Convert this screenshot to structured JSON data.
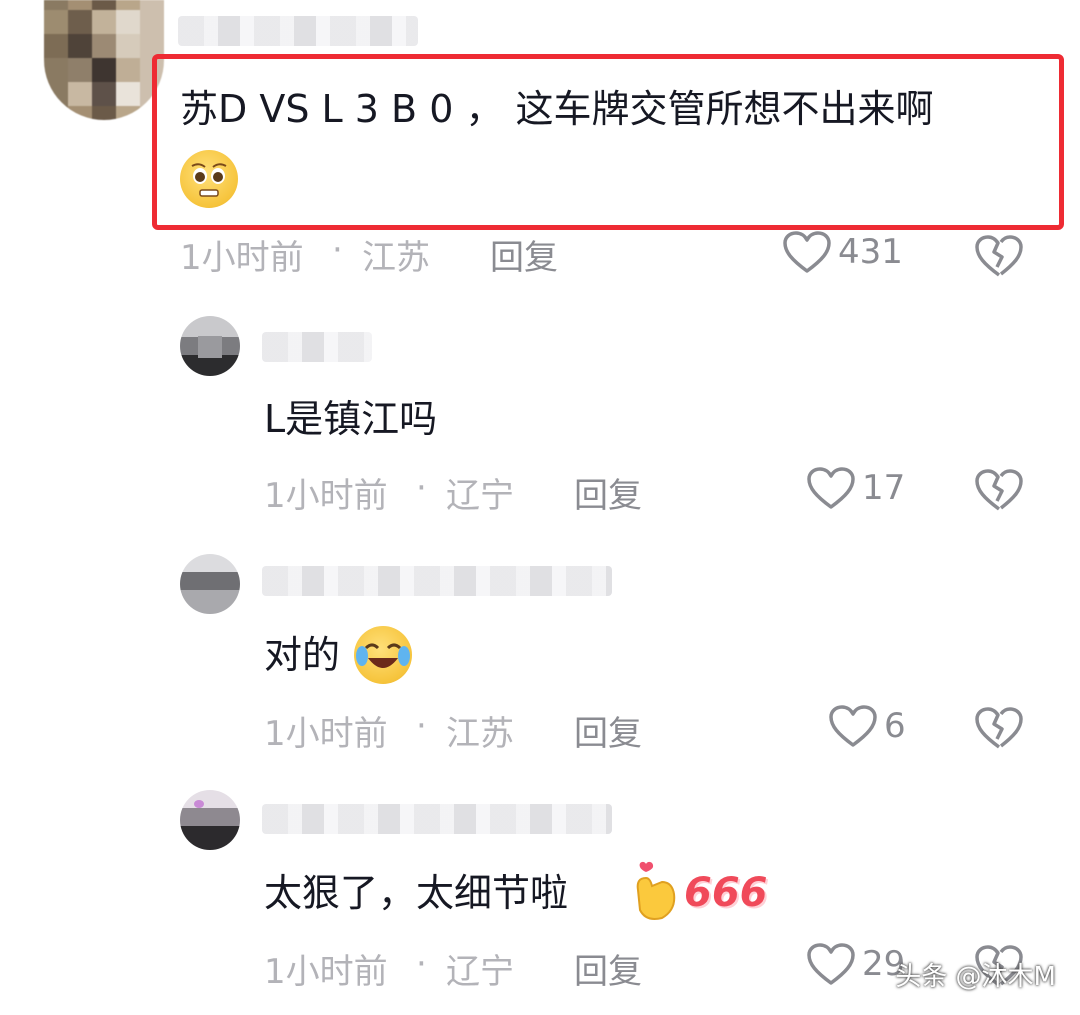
{
  "main_comment": {
    "text_line1": "苏D VS L 3 B 0 ， 这车牌交管所想不出来啊",
    "emoji_icon": "pleading-face-emoji",
    "time": "1小时前",
    "location": "江苏",
    "reply_label": "回复",
    "likes": "431"
  },
  "replies": [
    {
      "text": "L是镇江吗",
      "time": "1小时前",
      "location": "辽宁",
      "reply_label": "回复",
      "likes": "17"
    },
    {
      "text": "对的",
      "emoji_icon": "laughing-crying-emoji",
      "time": "1小时前",
      "location": "江苏",
      "reply_label": "回复",
      "likes": "6"
    },
    {
      "text": "太狠了，太细节啦",
      "emoji_icon": "finger-heart-emoji",
      "sticker_text": "666",
      "time": "1小时前",
      "location": "辽宁",
      "reply_label": "回复",
      "likes": "29"
    }
  ],
  "separator": "·",
  "watermark": "头条 @沐木M",
  "colors": {
    "highlight_border": "#ee2b33",
    "text_primary": "#161823",
    "text_meta": "#b3b3b8",
    "text_secondary": "#8a8b91"
  }
}
